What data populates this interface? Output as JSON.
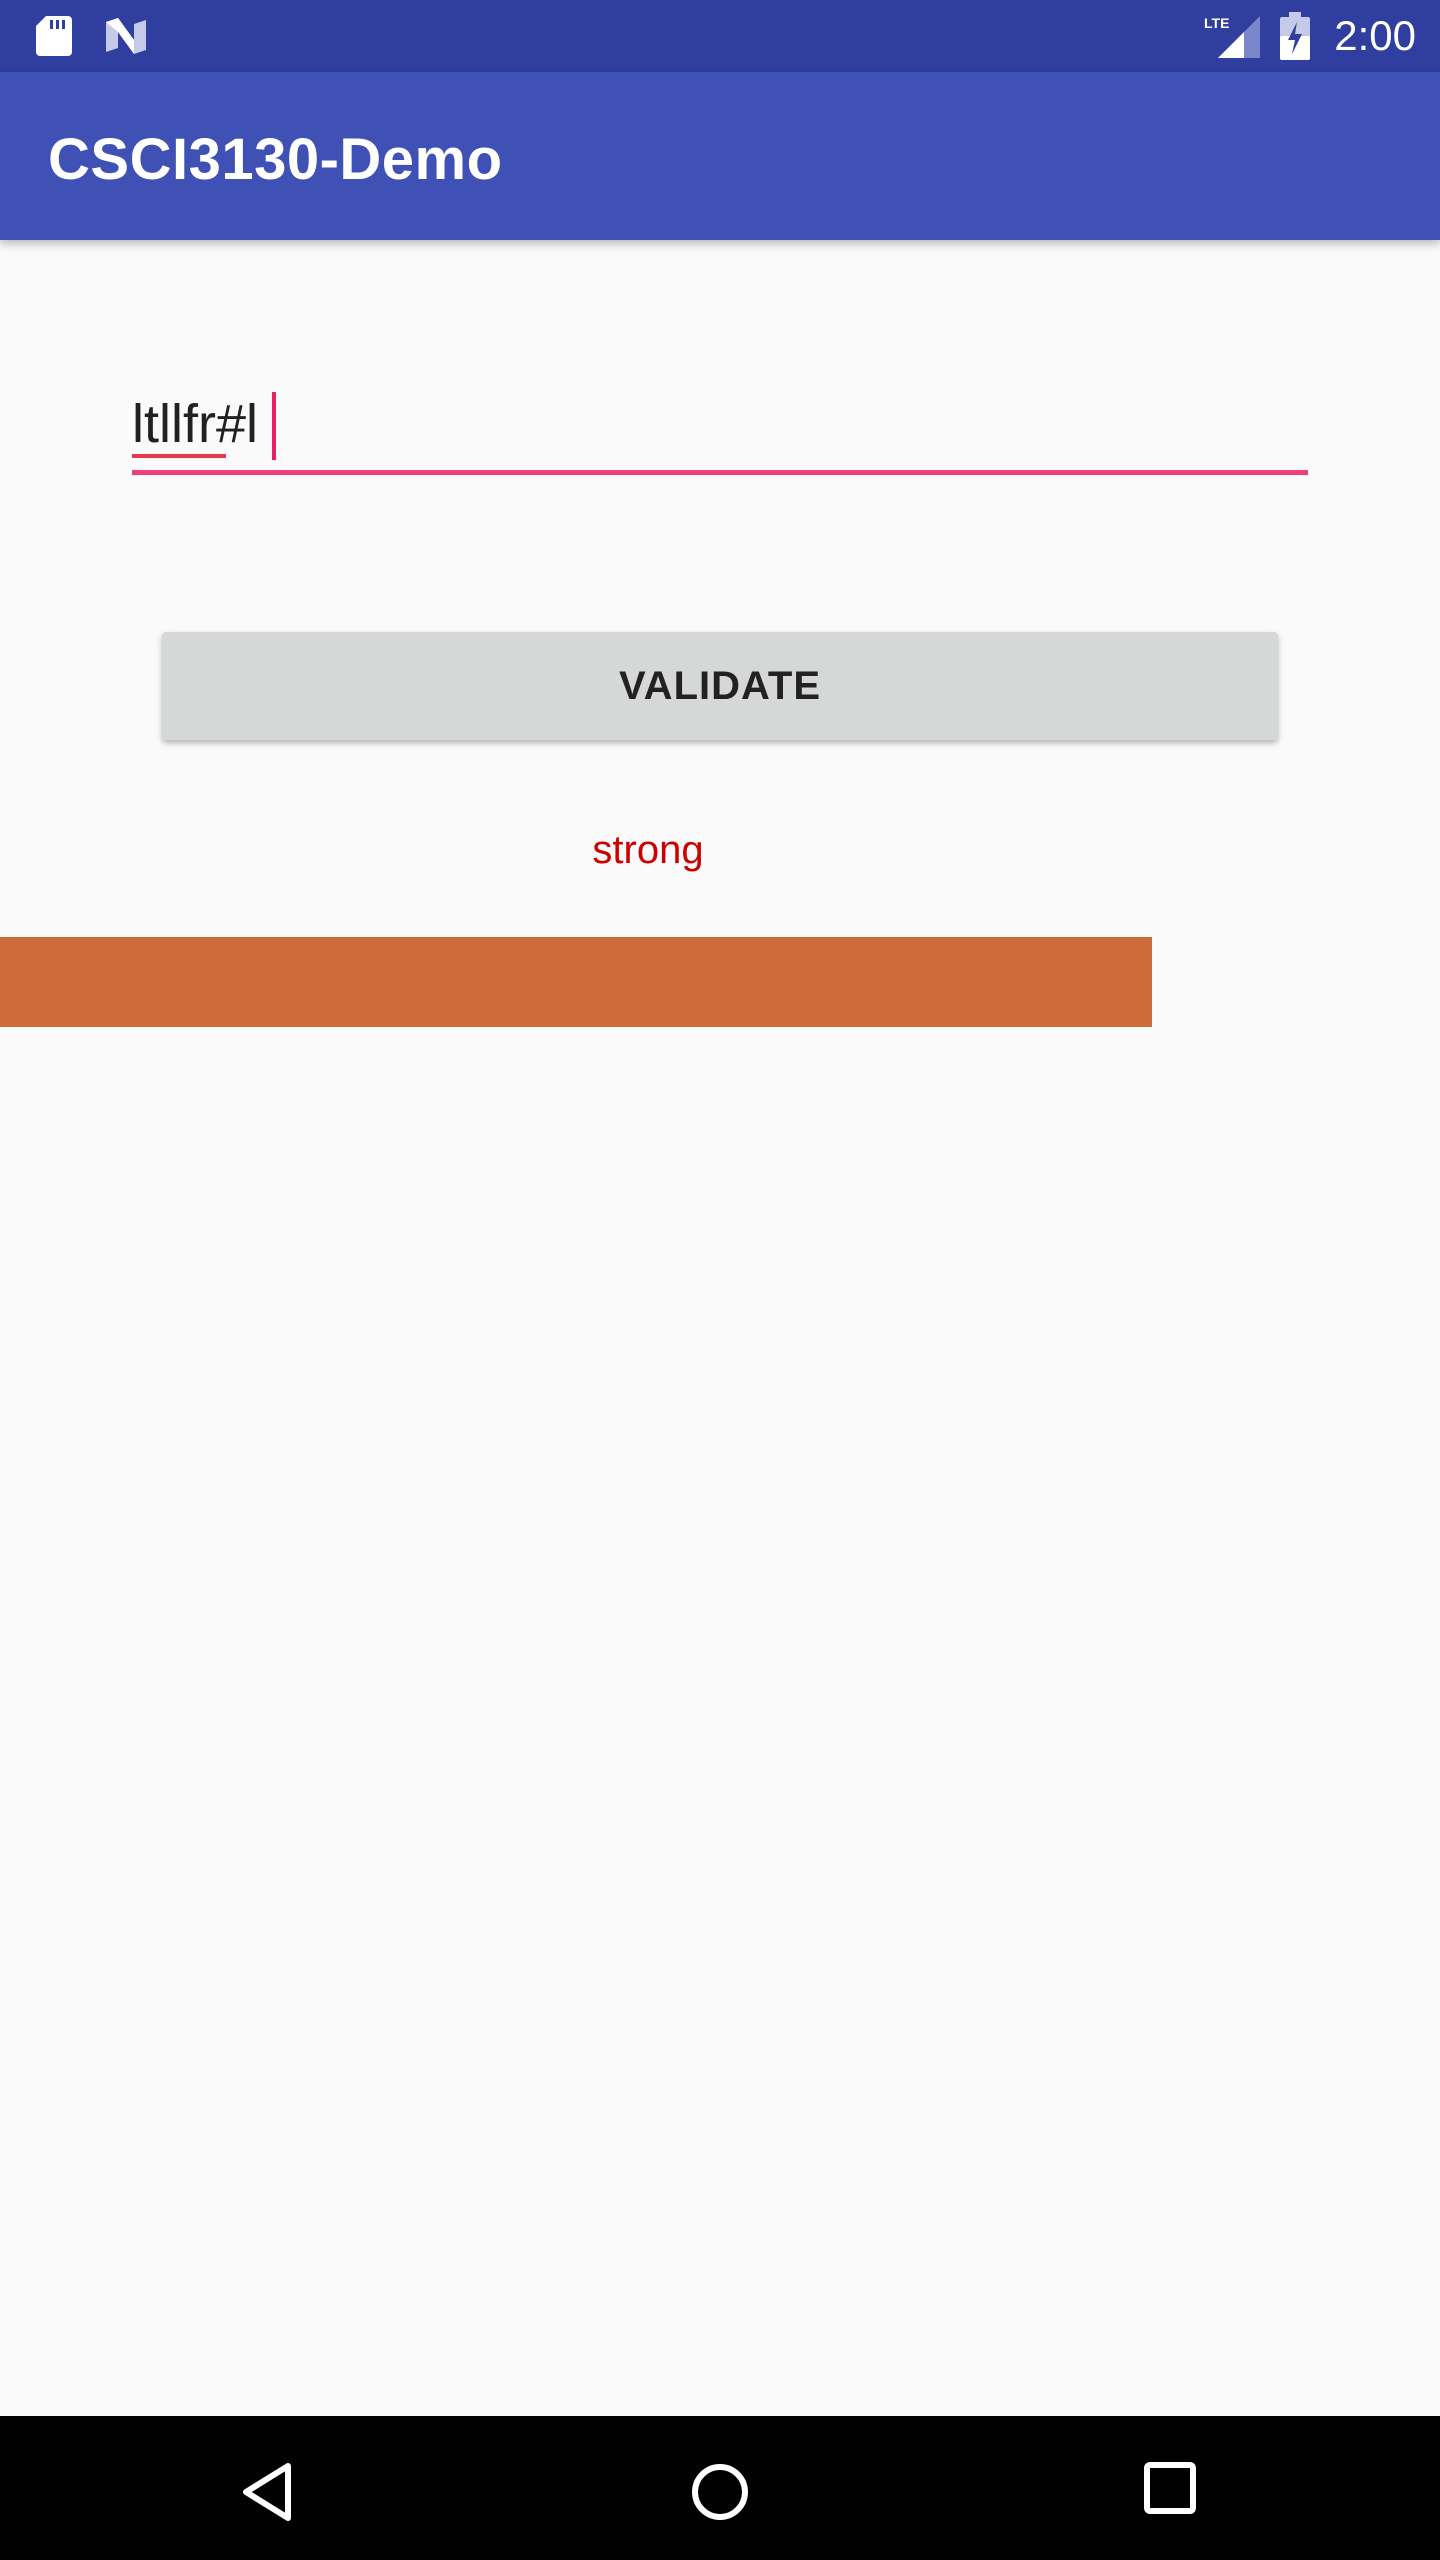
{
  "status_bar": {
    "time": "2:00",
    "network": "LTE",
    "icons": [
      "sd-card-icon",
      "n-notification-icon",
      "lte-signal-icon",
      "battery-icon"
    ]
  },
  "app_bar": {
    "title": "CSCI3130-Demo"
  },
  "password_input": {
    "value": "ltllfr#l"
  },
  "validate_button": {
    "label": "VALIDATE"
  },
  "result": {
    "strength_label": "strong"
  },
  "strength_bar": {
    "fill_fraction": 0.8
  },
  "nav_bar": {
    "icons": [
      "back-icon",
      "home-icon",
      "recents-icon"
    ]
  },
  "colors": {
    "status_bar": "#303f9f",
    "app_bar": "#3f51b5",
    "accent": "#ec407a",
    "result_text": "#cc0000",
    "strength_bar": "#cd6b3b",
    "button": "#d6d7d7",
    "background": "#fafafa"
  }
}
